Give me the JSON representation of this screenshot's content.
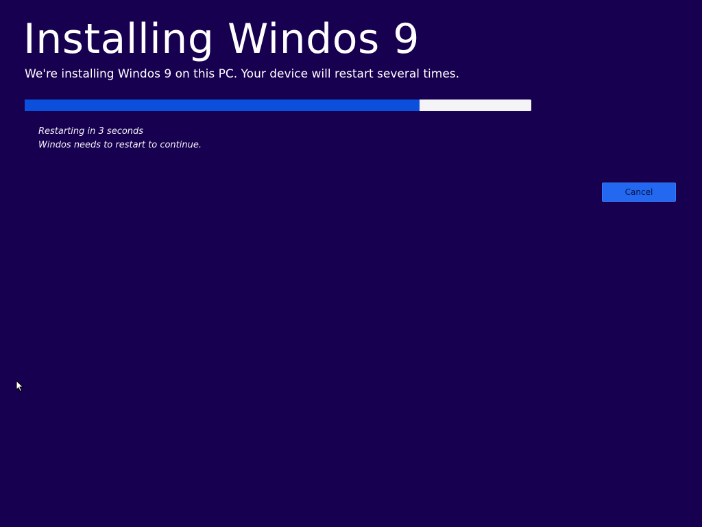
{
  "title": "Installing Windos 9",
  "subtitle": "We're installing Windos 9 on this PC. Your device will restart several times.",
  "progress": {
    "percent": 78,
    "fill_color": "#0a50dc",
    "track_color": "#f4f4f6"
  },
  "status": {
    "line1": "Restarting in 3 seconds",
    "line2": "Windos needs to restart to continue."
  },
  "cancel_button": {
    "label": "Cancel"
  },
  "colors": {
    "background": "#180050",
    "accent": "#2268f0"
  },
  "cursor": {
    "icon": "mouse-pointer-icon"
  }
}
